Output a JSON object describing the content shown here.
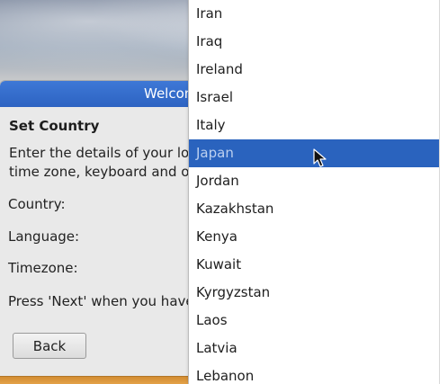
{
  "dialog": {
    "title": "Welcom",
    "section_title": "Set Country",
    "description_line1": "Enter the details of your loca",
    "description_line2": "time zone, keyboard and othe",
    "labels": {
      "country": "Country:",
      "language": "Language:",
      "timezone": "Timezone:"
    },
    "hint": "Press 'Next' when you have m",
    "back_label": "Back"
  },
  "country_dropdown": {
    "items": [
      {
        "label": "Iran"
      },
      {
        "label": "Iraq"
      },
      {
        "label": "Ireland"
      },
      {
        "label": "Israel"
      },
      {
        "label": "Italy"
      },
      {
        "label": "Japan"
      },
      {
        "label": "Jordan"
      },
      {
        "label": "Kazakhstan"
      },
      {
        "label": "Kenya"
      },
      {
        "label": "Kuwait"
      },
      {
        "label": "Kyrgyzstan"
      },
      {
        "label": "Laos"
      },
      {
        "label": "Latvia"
      },
      {
        "label": "Lebanon"
      }
    ],
    "selected_index": 5,
    "highlight_color": "#2a63be"
  }
}
